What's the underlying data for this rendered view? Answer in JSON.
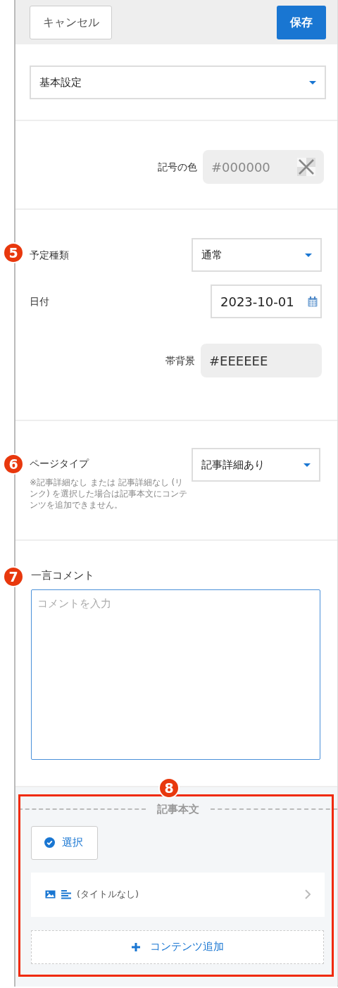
{
  "header": {
    "cancel_button": "キャンセル",
    "save_button": "保存"
  },
  "settings_select": {
    "value": "基本設定"
  },
  "symbol_color": {
    "label": "記号の色",
    "value": "#000000"
  },
  "schedule": {
    "badge": "5",
    "type_label": "予定種類",
    "type_value": "通常",
    "date_label": "日付",
    "date_value": "2023-10-01",
    "band_label": "帯背景",
    "band_value": "#EEEEEE"
  },
  "page_type": {
    "badge": "6",
    "label": "ページタイプ",
    "value": "記事詳細あり",
    "note": "※記事詳細なし または 記事詳細なし (リンク) を選択した場合は記事本文にコンテンツを追加できません。"
  },
  "comment": {
    "badge": "7",
    "label": "一言コメント",
    "placeholder": "コメントを入力"
  },
  "article_body": {
    "badge": "8",
    "title": "記事本文",
    "select_button": "選択",
    "items": [
      {
        "title": "(タイトルなし)"
      }
    ],
    "add_button": "コンテンツ追加"
  }
}
